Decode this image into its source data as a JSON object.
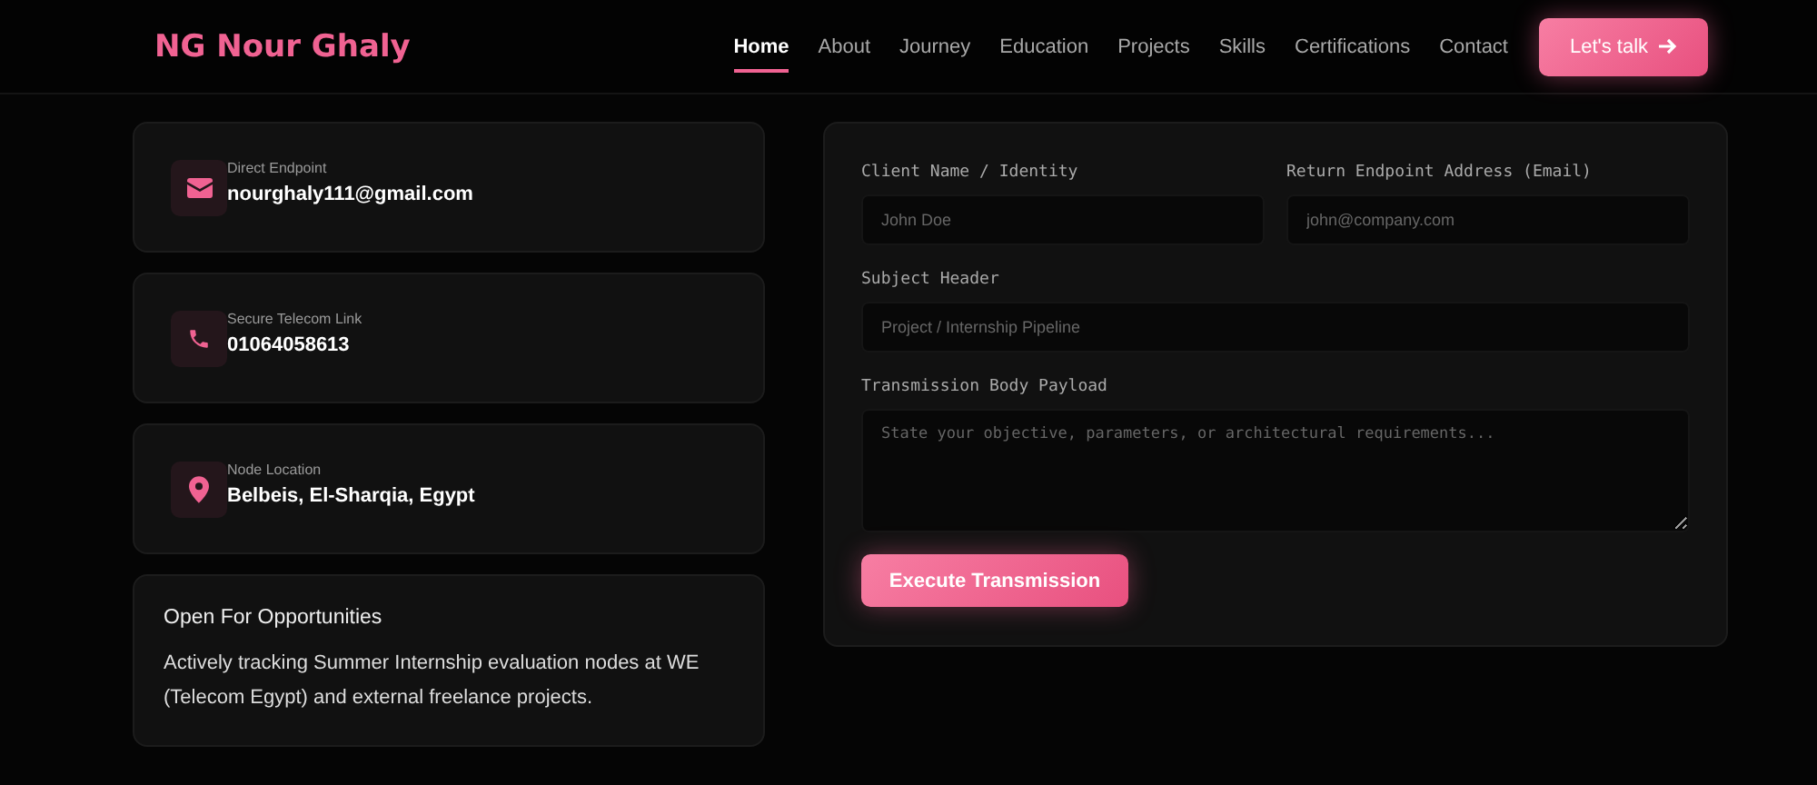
{
  "header": {
    "logo": "NG Nour Ghaly",
    "nav": [
      {
        "label": "Home",
        "selected": true
      },
      {
        "label": "About",
        "selected": false
      },
      {
        "label": "Journey",
        "selected": false
      },
      {
        "label": "Education",
        "selected": false
      },
      {
        "label": "Projects",
        "selected": false
      },
      {
        "label": "Skills",
        "selected": false
      },
      {
        "label": "Certifications",
        "selected": false
      },
      {
        "label": "Contact",
        "selected": false
      }
    ],
    "cta": "Let's talk"
  },
  "contacts": [
    {
      "kind": "email",
      "label": "Direct Endpoint",
      "value": "nourghaly111@gmail.com"
    },
    {
      "kind": "phone",
      "label": "Secure Telecom Link",
      "value": "01064058613"
    },
    {
      "kind": "location",
      "label": "Node Location",
      "value": "Belbeis, El-Sharqia, Egypt"
    }
  ],
  "availability": {
    "title": "Open For Opportunities",
    "text": "Actively tracking Summer Internship evaluation nodes at WE (Telecom Egypt) and external freelance projects."
  },
  "form": {
    "fields": [
      {
        "kind": "input",
        "label": "Client Name / Identity",
        "placeholder": "John Doe",
        "full_width": false
      },
      {
        "kind": "input",
        "label": "Return Endpoint Address (Email)",
        "placeholder": "john@company.com",
        "full_width": false
      },
      {
        "kind": "input",
        "label": "Subject Header",
        "placeholder": "Project / Internship Pipeline",
        "full_width": true
      },
      {
        "kind": "textarea",
        "label": "Transmission Body Payload",
        "placeholder": "State your objective, parameters, or architectural requirements...",
        "full_width": true
      }
    ],
    "submit": "Execute Transmission"
  }
}
